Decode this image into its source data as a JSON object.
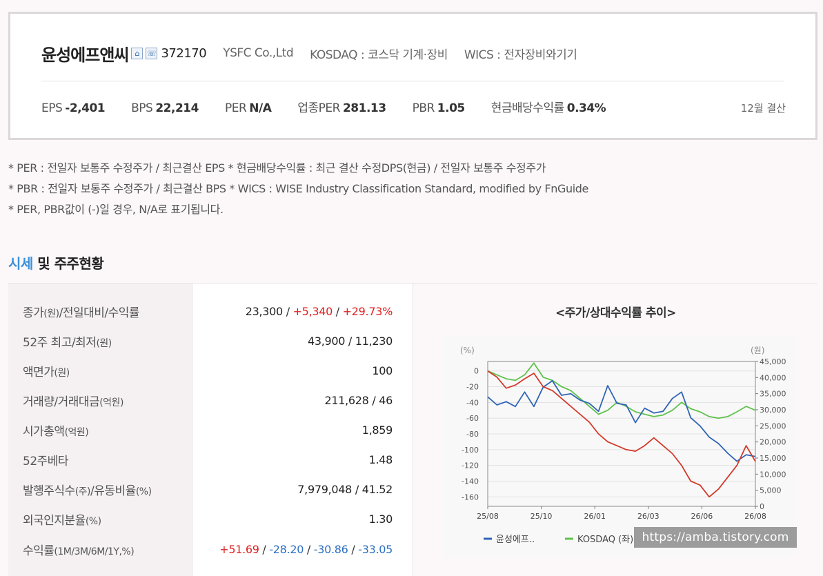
{
  "header": {
    "company_name": "윤성에프앤씨",
    "code": "372170",
    "english_name": "YSFC Co.,Ltd",
    "market": "KOSDAQ : 코스닥 기계·장비",
    "wics": "WICS : 전자장비와기기",
    "icons": [
      "home-icon",
      "phone-icon"
    ]
  },
  "metrics": [
    {
      "label": "EPS",
      "value": "-2,401"
    },
    {
      "label": "BPS",
      "value": "22,214"
    },
    {
      "label": "PER",
      "value": "N/A"
    },
    {
      "label": "업종PER",
      "value": "281.13"
    },
    {
      "label": "PBR",
      "value": "1.05"
    },
    {
      "label": "현금배당수익률",
      "value": "0.34%"
    }
  ],
  "fiscal": "12월 결산",
  "notes": [
    "* PER : 전일자 보통주 수정주가 / 최근결산 EPS * 현금배당수익률 : 최근 결산 수정DPS(현금) / 전일자 보통주 수정주가",
    "* PBR : 전일자 보통주 수정주가 / 최근결산 BPS * WICS : WISE Industry Classification Standard, modified by FnGuide",
    "* PER, PBR값이 (-)일 경우, N/A로 표기됩니다."
  ],
  "section": {
    "accent": "시세",
    "rest": " 및 주주현황"
  },
  "table": {
    "rows": [
      {
        "label": "종가",
        "unit": "(원)",
        "label2": "/전일대비/수익률",
        "value": "23,300",
        "v2": "+5,340",
        "v3": "+29.73%"
      },
      {
        "label": "52주 최고/최저",
        "unit": "(원)",
        "value": "43,900 / 11,230"
      },
      {
        "label": "액면가",
        "unit": "(원)",
        "value": "100"
      },
      {
        "label": "거래량/거래대금",
        "unit": "(억원)",
        "value": "211,628 / 46"
      },
      {
        "label": "시가총액",
        "unit": "(억원)",
        "value": "1,859"
      },
      {
        "label": "52주베타",
        "unit": "",
        "value": "1.48"
      },
      {
        "label": "발행주식수",
        "unit": "(주)",
        "label2": "/유동비율",
        "unit2": "(%)",
        "value": "7,979,048 / 41.52"
      },
      {
        "label": "외국인지분율",
        "unit": "(%)",
        "value": "1.30"
      },
      {
        "label": "수익률",
        "unit": "(1M/3M/6M/1Y,%)",
        "r1": "+51.69",
        "r2": "-28.20",
        "r3": "-30.86",
        "r4": "-33.05"
      }
    ]
  },
  "chart_title": "<주가/상대수익률 추이>",
  "watermark": "https://amba.tistory.com",
  "chart_data": {
    "type": "line",
    "left_axis_label": "(%)",
    "right_axis_label": "(원)",
    "x_ticks": [
      "25/08",
      "25/10",
      "26/01",
      "26/03",
      "26/06",
      "26/08"
    ],
    "y_left_ticks": [
      0,
      -20,
      -40,
      -60,
      -80,
      -100,
      -120,
      -140,
      -160
    ],
    "y_left_range": [
      -172,
      12
    ],
    "y_right_ticks": [
      "45,000",
      "40,000",
      "35,000",
      "30,000",
      "25,000",
      "20,000",
      "15,000",
      "10,000",
      "5,000",
      "0"
    ],
    "y_right_range": [
      0,
      45000
    ],
    "legend": [
      "윤성에프..",
      "KOSDAQ (좌)"
    ],
    "colors": {
      "price": "#2f64b5",
      "kosdaq": "#5ec24a",
      "relative": "#d23a2a"
    },
    "series": [
      {
        "name": "윤성에프..",
        "axis": "right",
        "values": [
          34000,
          31500,
          32500,
          31000,
          35500,
          31000,
          37000,
          39000,
          34500,
          35000,
          33000,
          32000,
          29500,
          37500,
          32000,
          31500,
          26000,
          30500,
          29000,
          29500,
          33500,
          35500,
          27500,
          25000,
          21500,
          19500,
          16500,
          14000,
          16000,
          15500
        ]
      },
      {
        "name": "KOSDAQ (좌)",
        "axis": "left",
        "values": [
          0,
          -5,
          -10,
          -12,
          -5,
          10,
          -8,
          -12,
          -20,
          -25,
          -35,
          -45,
          -55,
          -50,
          -40,
          -45,
          -52,
          -55,
          -58,
          -56,
          -50,
          -40,
          -48,
          -52,
          -58,
          -60,
          -58,
          -52,
          -45,
          -50
        ]
      },
      {
        "name": "",
        "axis": "left",
        "values": [
          0,
          -8,
          -22,
          -18,
          -10,
          -3,
          -20,
          -25,
          -35,
          -45,
          -55,
          -65,
          -80,
          -90,
          -95,
          -100,
          -102,
          -95,
          -85,
          -95,
          -105,
          -120,
          -140,
          -145,
          -160,
          -150,
          -135,
          -120,
          -95,
          -115
        ]
      }
    ]
  }
}
